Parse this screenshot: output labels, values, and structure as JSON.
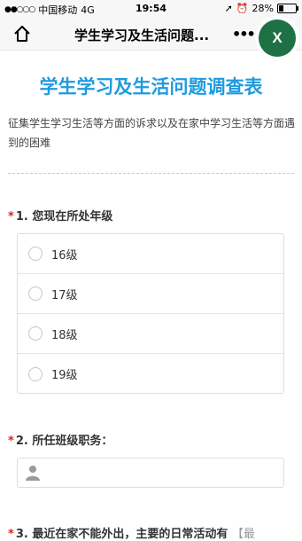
{
  "status_bar": {
    "carrier": "中国移动",
    "network": "4G",
    "time": "19:54",
    "battery": "28%",
    "battery_level": 0.28
  },
  "nav": {
    "title": "学生学习及生活问题...",
    "close_label": "X"
  },
  "survey": {
    "title": "学生学习及生活问题调查表",
    "description": "征集学生学习生活等方面的诉求以及在家中学习生活等方面遇到的困难"
  },
  "questions": [
    {
      "required": "*",
      "title": "1. 您现在所处年级",
      "options": [
        "16级",
        "17级",
        "18级",
        "19级"
      ]
    },
    {
      "required": "*",
      "title": "2. 所任班级职务：",
      "value": ""
    },
    {
      "required": "*",
      "title": "3. 最近在家不能外出，主要的日常活动有",
      "hint": "【最"
    }
  ],
  "colors": {
    "accent": "#1e9be0",
    "required": "#e02020",
    "fab": "#1e7145"
  }
}
